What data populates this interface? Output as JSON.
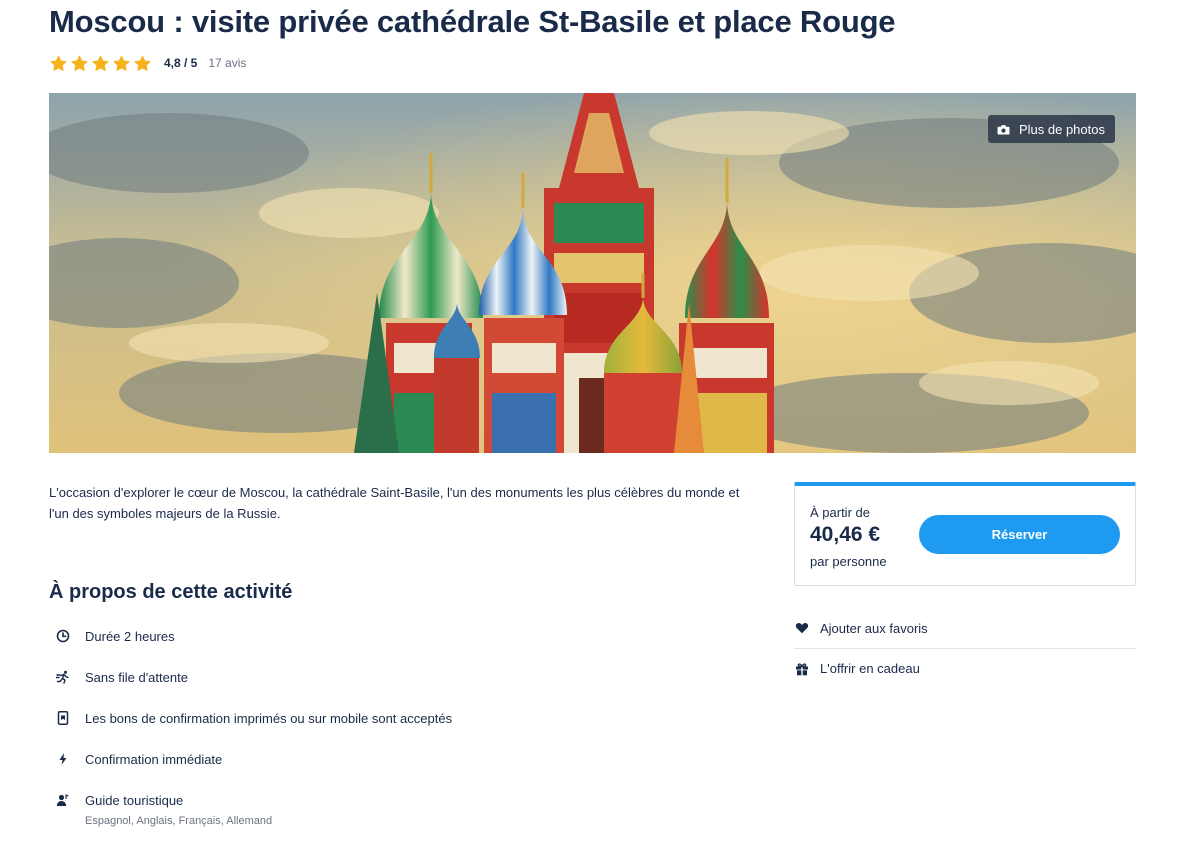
{
  "header": {
    "title": "Moscou : visite privée cathédrale St-Basile et place Rouge",
    "rating_value": "4,8 / 5",
    "rating_count": "17 avis",
    "stars": 5,
    "star_color": "#f5b21b"
  },
  "gallery": {
    "more_photos_label": "Plus de photos",
    "icon": "camera-icon"
  },
  "description": "L'occasion d'explorer le cœur de Moscou, la cathédrale Saint-Basile, l'un des monuments les plus célèbres du monde et l'un des symboles majeurs de la Russie.",
  "about": {
    "title": "À propos de cette activité",
    "items": [
      {
        "icon": "clock-icon",
        "label": "Durée 2 heures"
      },
      {
        "icon": "running-person-icon",
        "label": "Sans file d'attente"
      },
      {
        "icon": "mobile-ticket-icon",
        "label": "Les bons de confirmation imprimés ou sur mobile sont acceptés"
      },
      {
        "icon": "lightning-icon",
        "label": "Confirmation immédiate"
      },
      {
        "icon": "guide-icon",
        "label": "Guide touristique",
        "sub": "Espagnol, Anglais, Français, Allemand"
      }
    ]
  },
  "booking": {
    "from_label": "À partir de",
    "price": "40,46 €",
    "per_label": "par personne",
    "reserve_label": "Réserver",
    "accent_color": "#1e9bf0"
  },
  "side_actions": [
    {
      "icon": "heart-icon",
      "label": "Ajouter aux favoris"
    },
    {
      "icon": "gift-icon",
      "label": "L'offrir en cadeau"
    }
  ]
}
